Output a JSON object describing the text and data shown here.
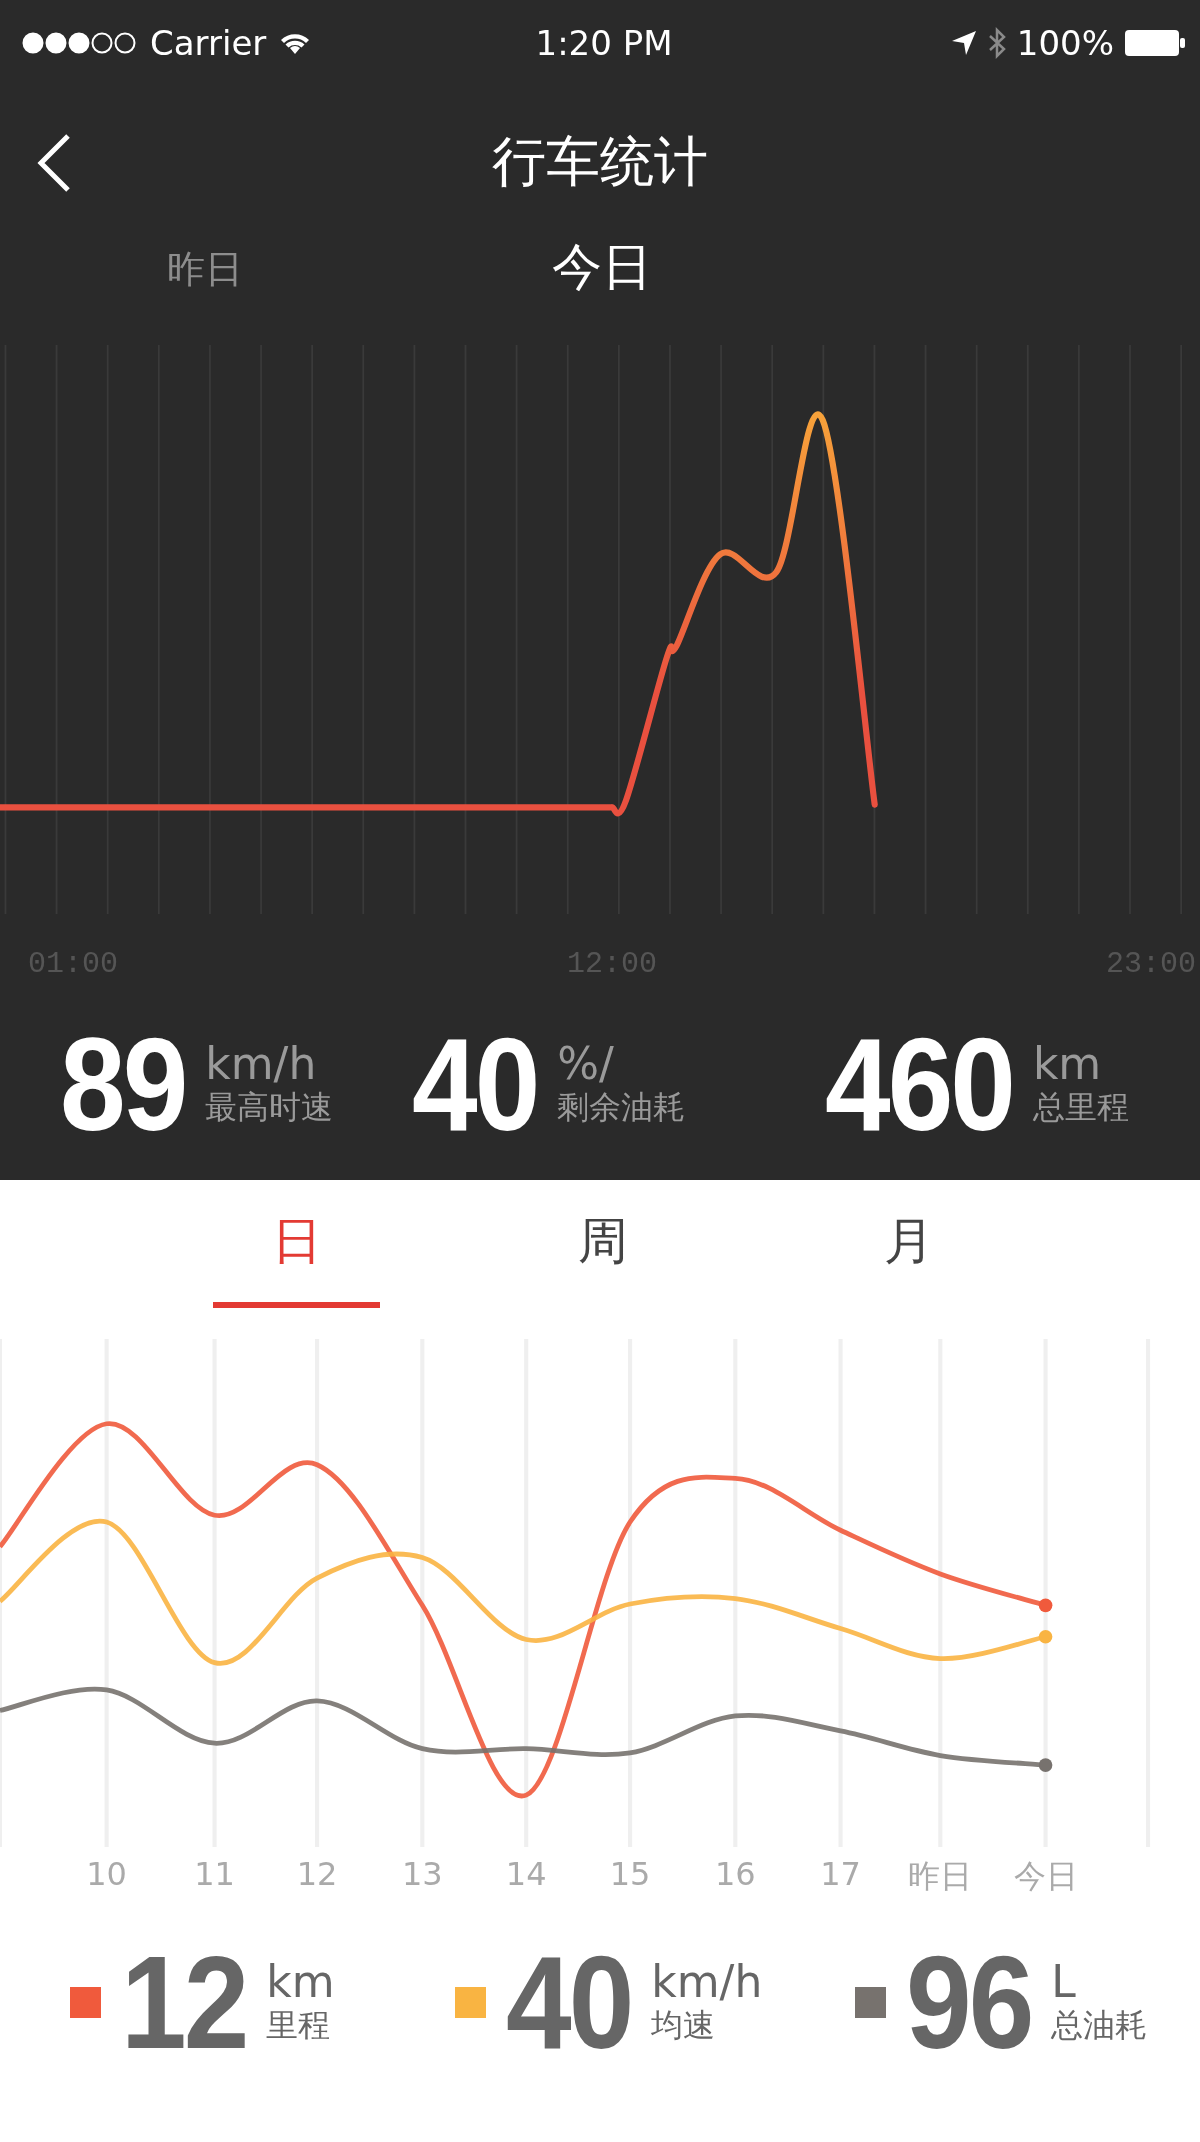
{
  "status_bar": {
    "carrier": "Carrier",
    "time": "1:20 PM",
    "battery": "100%"
  },
  "nav": {
    "title": "行车统计"
  },
  "day_tabs": [
    {
      "label": "昨日",
      "selected": false
    },
    {
      "label": "今日",
      "selected": true
    }
  ],
  "speed_chart": {
    "x_labels": [
      "01:00",
      "12:00",
      "23:00"
    ]
  },
  "stats": [
    {
      "value": "89",
      "unit": "km/h",
      "label": "最高时速"
    },
    {
      "value": "40",
      "unit": "%/",
      "label": "剩余油耗"
    },
    {
      "value": "460",
      "unit": "km",
      "label": "总里程"
    }
  ],
  "period_tabs": [
    {
      "label": "日",
      "selected": true
    },
    {
      "label": "周",
      "selected": false
    },
    {
      "label": "月",
      "selected": false
    }
  ],
  "trend_chart": {
    "x_labels": [
      "10",
      "11",
      "12",
      "13",
      "14",
      "15",
      "16",
      "17",
      "昨日",
      "今日"
    ]
  },
  "legend": [
    {
      "value": "12",
      "unit": "km",
      "label": "里程",
      "color": "#f05a3c"
    },
    {
      "value": "40",
      "unit": "km/h",
      "label": "均速",
      "color": "#f9b442"
    },
    {
      "value": "96",
      "unit": "L",
      "label": "总油耗",
      "color": "#77726e"
    }
  ]
}
